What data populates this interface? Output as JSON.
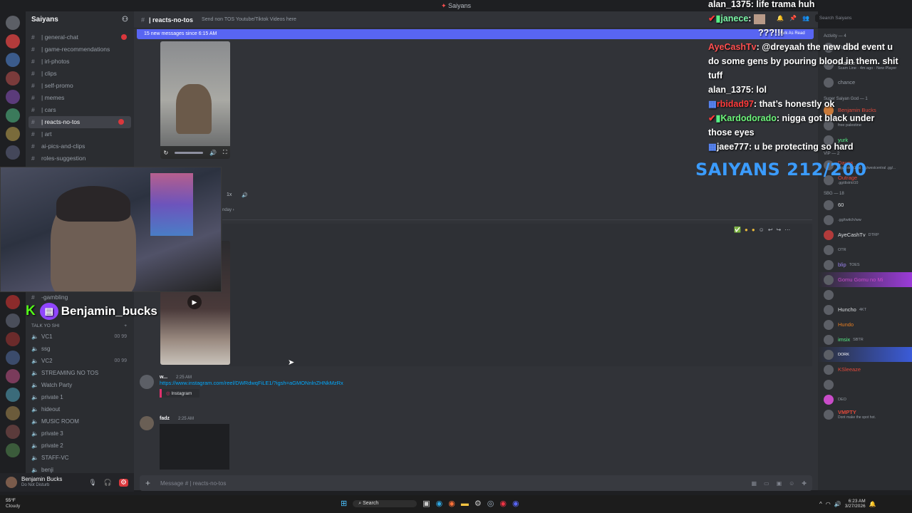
{
  "window": {
    "title": "Saiyans"
  },
  "server": {
    "name": "Saiyans"
  },
  "channels": [
    {
      "name": "| general-chat",
      "unread": true
    },
    {
      "name": "| game-recommendations",
      "unread": false
    },
    {
      "name": "| irl-photos",
      "unread": false
    },
    {
      "name": "| clips",
      "unread": false
    },
    {
      "name": "| self-promo",
      "unread": false
    },
    {
      "name": "| memes",
      "unread": false
    },
    {
      "name": "| cars",
      "unread": false
    },
    {
      "name": "| reacts-no-tos",
      "unread": true,
      "active": true
    },
    {
      "name": "| art",
      "unread": false
    },
    {
      "name": "ai-pics-and-clips",
      "unread": false
    },
    {
      "name": "roles-suggestion",
      "unread": false
    }
  ],
  "lower_channel": {
    "name": "-gambling"
  },
  "voice_category": "TALK YO SHI",
  "voice_channels": [
    {
      "name": "VC1",
      "count": "00 99"
    },
    {
      "name": "ssg",
      "count": ""
    },
    {
      "name": "VC2",
      "count": "00 99"
    },
    {
      "name": "STREAMING NO TOS",
      "count": ""
    },
    {
      "name": "Watch Party",
      "count": ""
    },
    {
      "name": "private 1",
      "count": ""
    },
    {
      "name": "hideout",
      "count": ""
    },
    {
      "name": "MUSIC ROOM",
      "count": ""
    },
    {
      "name": "private 3",
      "count": ""
    },
    {
      "name": "private 2",
      "count": ""
    },
    {
      "name": "STAFF-VC",
      "count": ""
    },
    {
      "name": "benji",
      "count": ""
    }
  ],
  "user": {
    "name": "Benjamin Bucks",
    "status": "Do Not Disturb"
  },
  "channel_header": {
    "name": "| reacts-no-tos",
    "topic": "Send non TOS Youtube/Tiktok Videos here"
  },
  "new_messages_banner": "15 new messages since 6:15 AM",
  "mark_read": "Mark As Read",
  "search": {
    "placeholder": "Search Saiyans"
  },
  "video_player": {
    "speed": "1x"
  },
  "date_divider": "nday",
  "messages": [
    {
      "author": "w...",
      "time": "2:25 AM",
      "link": "https://www.instagram.com/reel/DWRdwqFiLE1/?igsh=aGMONnlnZHNkMzRx",
      "embed": "Instagram"
    },
    {
      "author": "fadz",
      "time": "2:25 AM",
      "link": "",
      "embed": ""
    }
  ],
  "message_input": {
    "placeholder": "Message # | reacts-no-tos"
  },
  "chat_overlay": [
    {
      "user": "alan_1375",
      "color": "#ffffff",
      "text": "life trama huh"
    },
    {
      "user": "janece",
      "color": "#7cf7a8",
      "text": ""
    },
    {
      "user": "",
      "color": "#7aa6ff",
      "text": "???!!!"
    },
    {
      "user": "AyeCashTv",
      "color": "#ff4f4f",
      "text": "@dreyaah the new dbd event u"
    },
    {
      "user": "",
      "color": "#ffffff",
      "text": "do some gens by pouring blood in them. shit"
    },
    {
      "user": "",
      "color": "#ffffff",
      "text": "tuff"
    },
    {
      "user": "alan_1375",
      "color": "#ffffff",
      "text": "lol"
    },
    {
      "user": "rbidad97",
      "color": "#ff3b3b",
      "text": "that’s honestly ok"
    },
    {
      "user": "Kardodorado",
      "color": "#6cf57a",
      "text": "nigga got black under"
    },
    {
      "user": "",
      "color": "#ffffff",
      "text": "those eyes"
    },
    {
      "user": "jaee777",
      "color": "#ffffff",
      "text": "u be protecting so hard"
    }
  ],
  "saiyans_counter": "SAIYANS 212/200",
  "twitch_name": "Benjamin_bucks",
  "members": {
    "activity_header": "Activity — 4",
    "activity": [
      {
        "name": "Manyline",
        "sub": "1d ago"
      },
      {
        "name": "chance",
        "sub": "Scam Line · 4m ago · New Player"
      },
      {
        "name": "chance",
        "sub": "1d ago"
      }
    ],
    "god_header": "Super Saiyan God — 1",
    "god": [
      {
        "name": "Benjamin Bucks"
      }
    ],
    "top": [
      {
        "name": "",
        "sub": "free palestine"
      },
      {
        "name": "yurk",
        "sub": ""
      }
    ],
    "vip_header": "VIP — 2",
    "vip": [
      {
        "name": "Dayes",
        "sub": ".gg/district10al .gg/westcentral .gg/..."
      },
      {
        "name": "Outrage",
        "sub": ".gg/district10"
      }
    ],
    "sbg_header": "SBG — 18",
    "sbg": [
      {
        "name": "60",
        "tag": ""
      },
      {
        "name": "",
        "tag": ".gg/twitch/ww"
      },
      {
        "name": "AyeCashTv",
        "tag": "DTRP"
      },
      {
        "name": "",
        "tag": "OTR"
      },
      {
        "name": "blip",
        "tag": "TOES"
      },
      {
        "name": "Gomu Gomu no Mi",
        "tag": ""
      },
      {
        "name": "",
        "tag": ""
      },
      {
        "name": "Huncho",
        "tag": "4KT"
      },
      {
        "name": "Hundo",
        "tag": ""
      },
      {
        "name": "imsix",
        "tag": "SBTR"
      },
      {
        "name": "",
        "tag": "DORK"
      },
      {
        "name": "KSleeaze",
        "tag": ""
      },
      {
        "name": "",
        "tag": ""
      },
      {
        "name": "",
        "tag": "DEO"
      },
      {
        "name": "VMPTY",
        "tag": "Dont make the spot hot."
      }
    ]
  },
  "taskbar": {
    "weather_temp": "55°F",
    "weather_desc": "Cloudy",
    "search_label": "Search",
    "time": "6:23 AM",
    "date": "3/27/2026"
  },
  "colors": {
    "accent": "#5865f2",
    "saiyans": "#3b9cff",
    "twitch": "#9146ff"
  }
}
